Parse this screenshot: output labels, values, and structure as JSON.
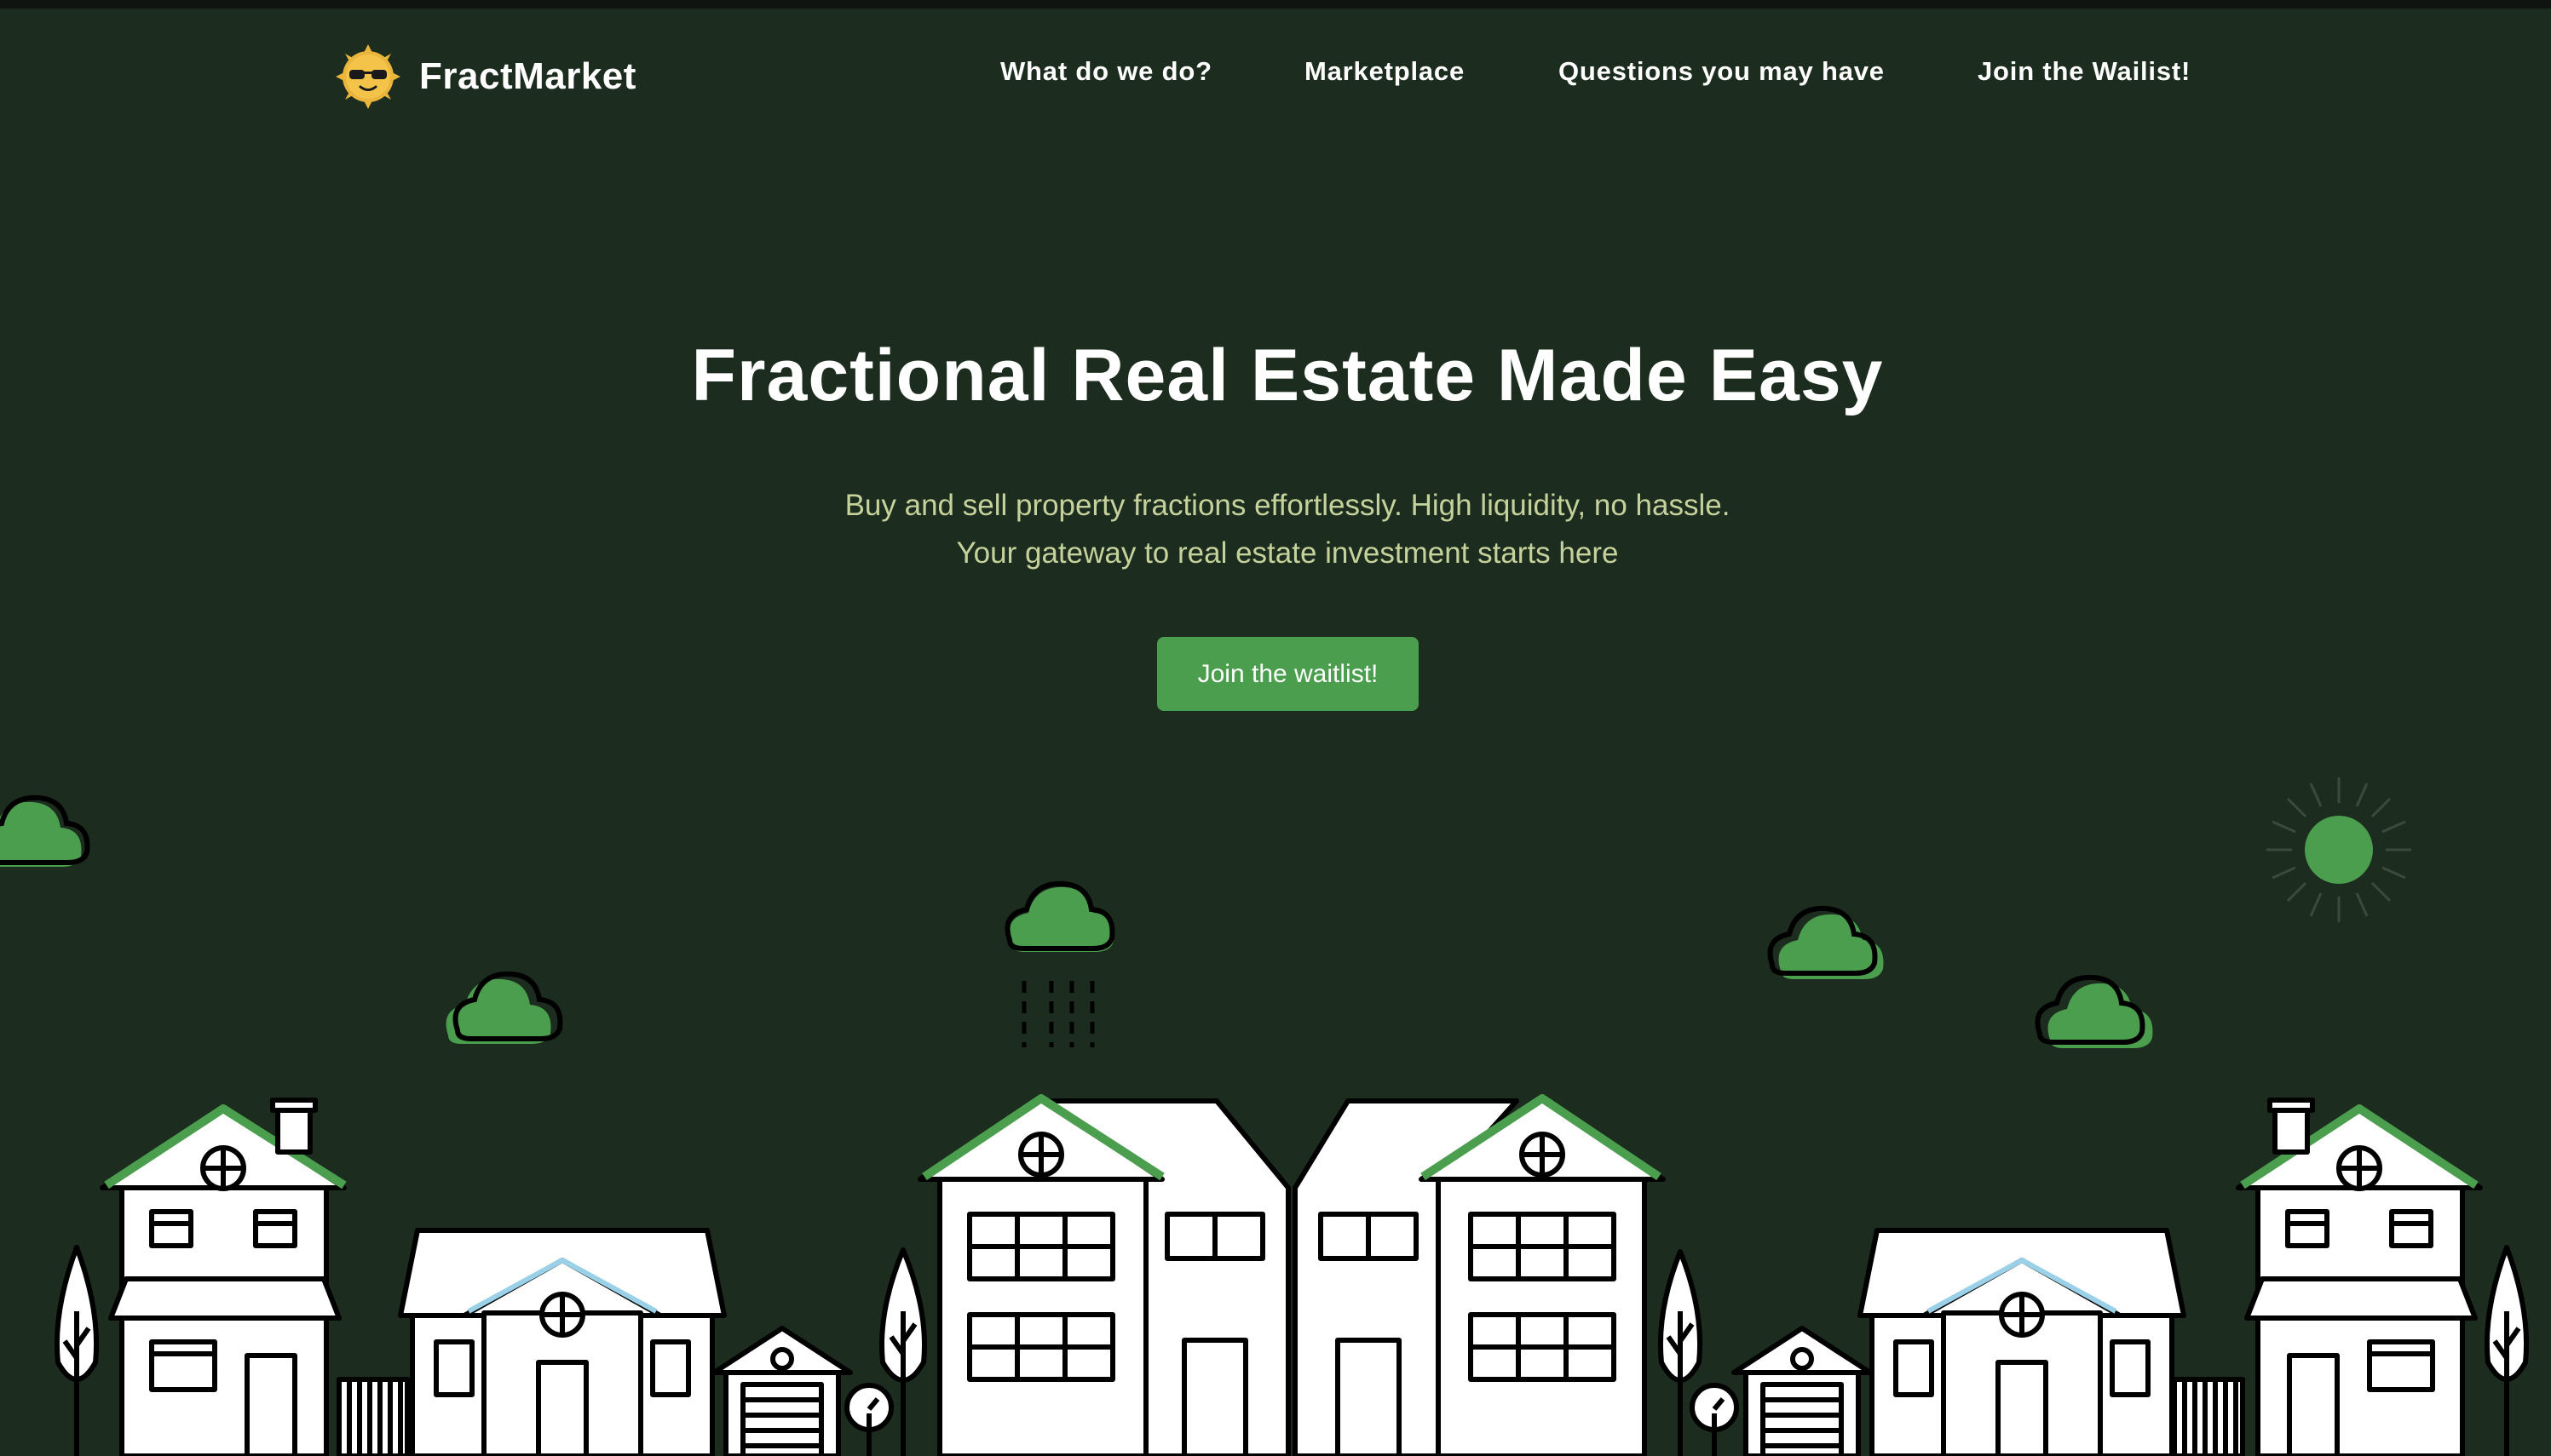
{
  "brand": {
    "name": "FractMarket"
  },
  "nav": {
    "items": [
      {
        "label": "What do we do?"
      },
      {
        "label": "Marketplace"
      },
      {
        "label": "Questions you may have"
      },
      {
        "label": "Join the Wailist!"
      }
    ]
  },
  "hero": {
    "title": "Fractional Real Estate Made Easy",
    "subtitle_line1": "Buy and sell property fractions effortlessly. High liquidity, no hassle.",
    "subtitle_line2": "Your gateway to real estate investment starts here",
    "cta_label": "Join the waitlist!"
  },
  "colors": {
    "background": "#1c2c1e",
    "accent": "#4a9e4d",
    "subtitle": "#c6d29c",
    "text": "#ffffff"
  },
  "icons": {
    "logo": "sun-with-sunglasses-icon",
    "clouds": "cloud-icon",
    "sun": "sun-icon",
    "rain": "rain-icon"
  }
}
